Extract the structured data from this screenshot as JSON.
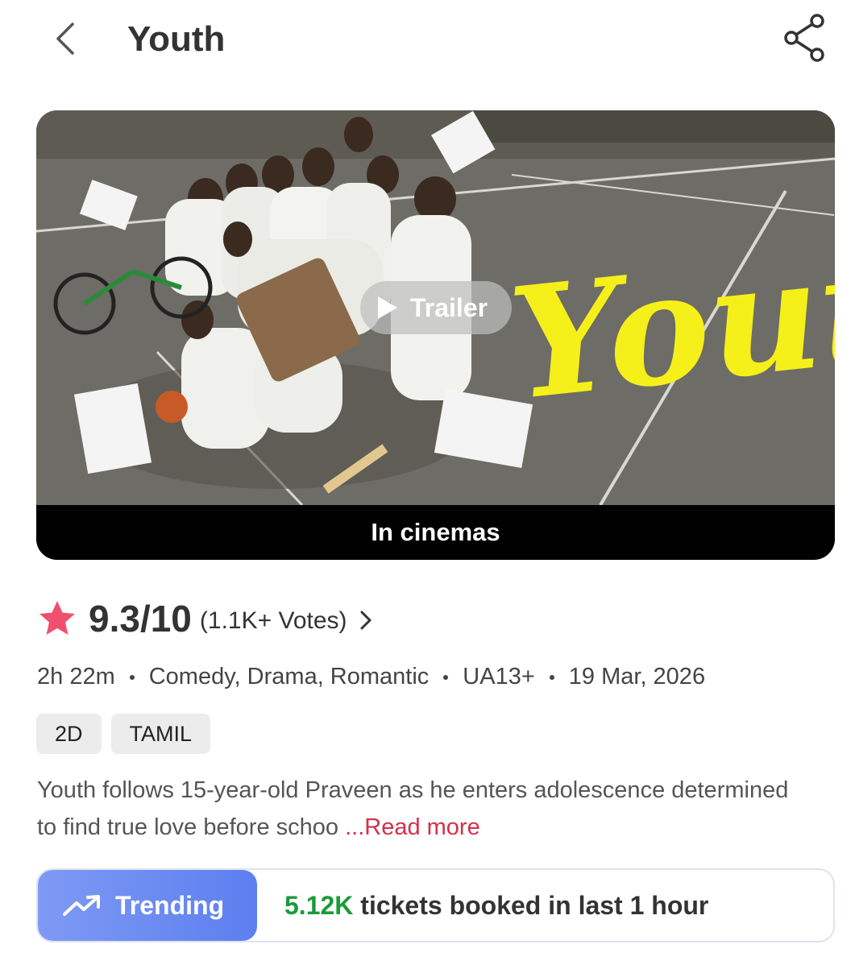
{
  "header": {
    "title": "Youth",
    "back_icon": "chevron-left-icon",
    "share_icon": "share-icon"
  },
  "hero": {
    "poster_title_text": "Youth",
    "trailer_label": "Trailer",
    "status": "In cinemas"
  },
  "rating": {
    "value": "9.3/10",
    "votes": "(1.1K+ Votes)",
    "star_color": "#f0506e"
  },
  "meta": {
    "duration": "2h 22m",
    "genres": "Comedy, Drama, Romantic",
    "certificate": "UA13+",
    "release_date": "19 Mar, 2026"
  },
  "tags": [
    "2D",
    "TAMIL"
  ],
  "description": {
    "text": "Youth follows 15-year-old Praveen as he enters adolescence determined to find true love before schoo",
    "read_more": "...Read more"
  },
  "trending": {
    "label": "Trending",
    "count": "5.12K",
    "text": " tickets booked in last 1 hour",
    "accent": "#5c7ff0",
    "count_color": "#1a9a3a"
  }
}
